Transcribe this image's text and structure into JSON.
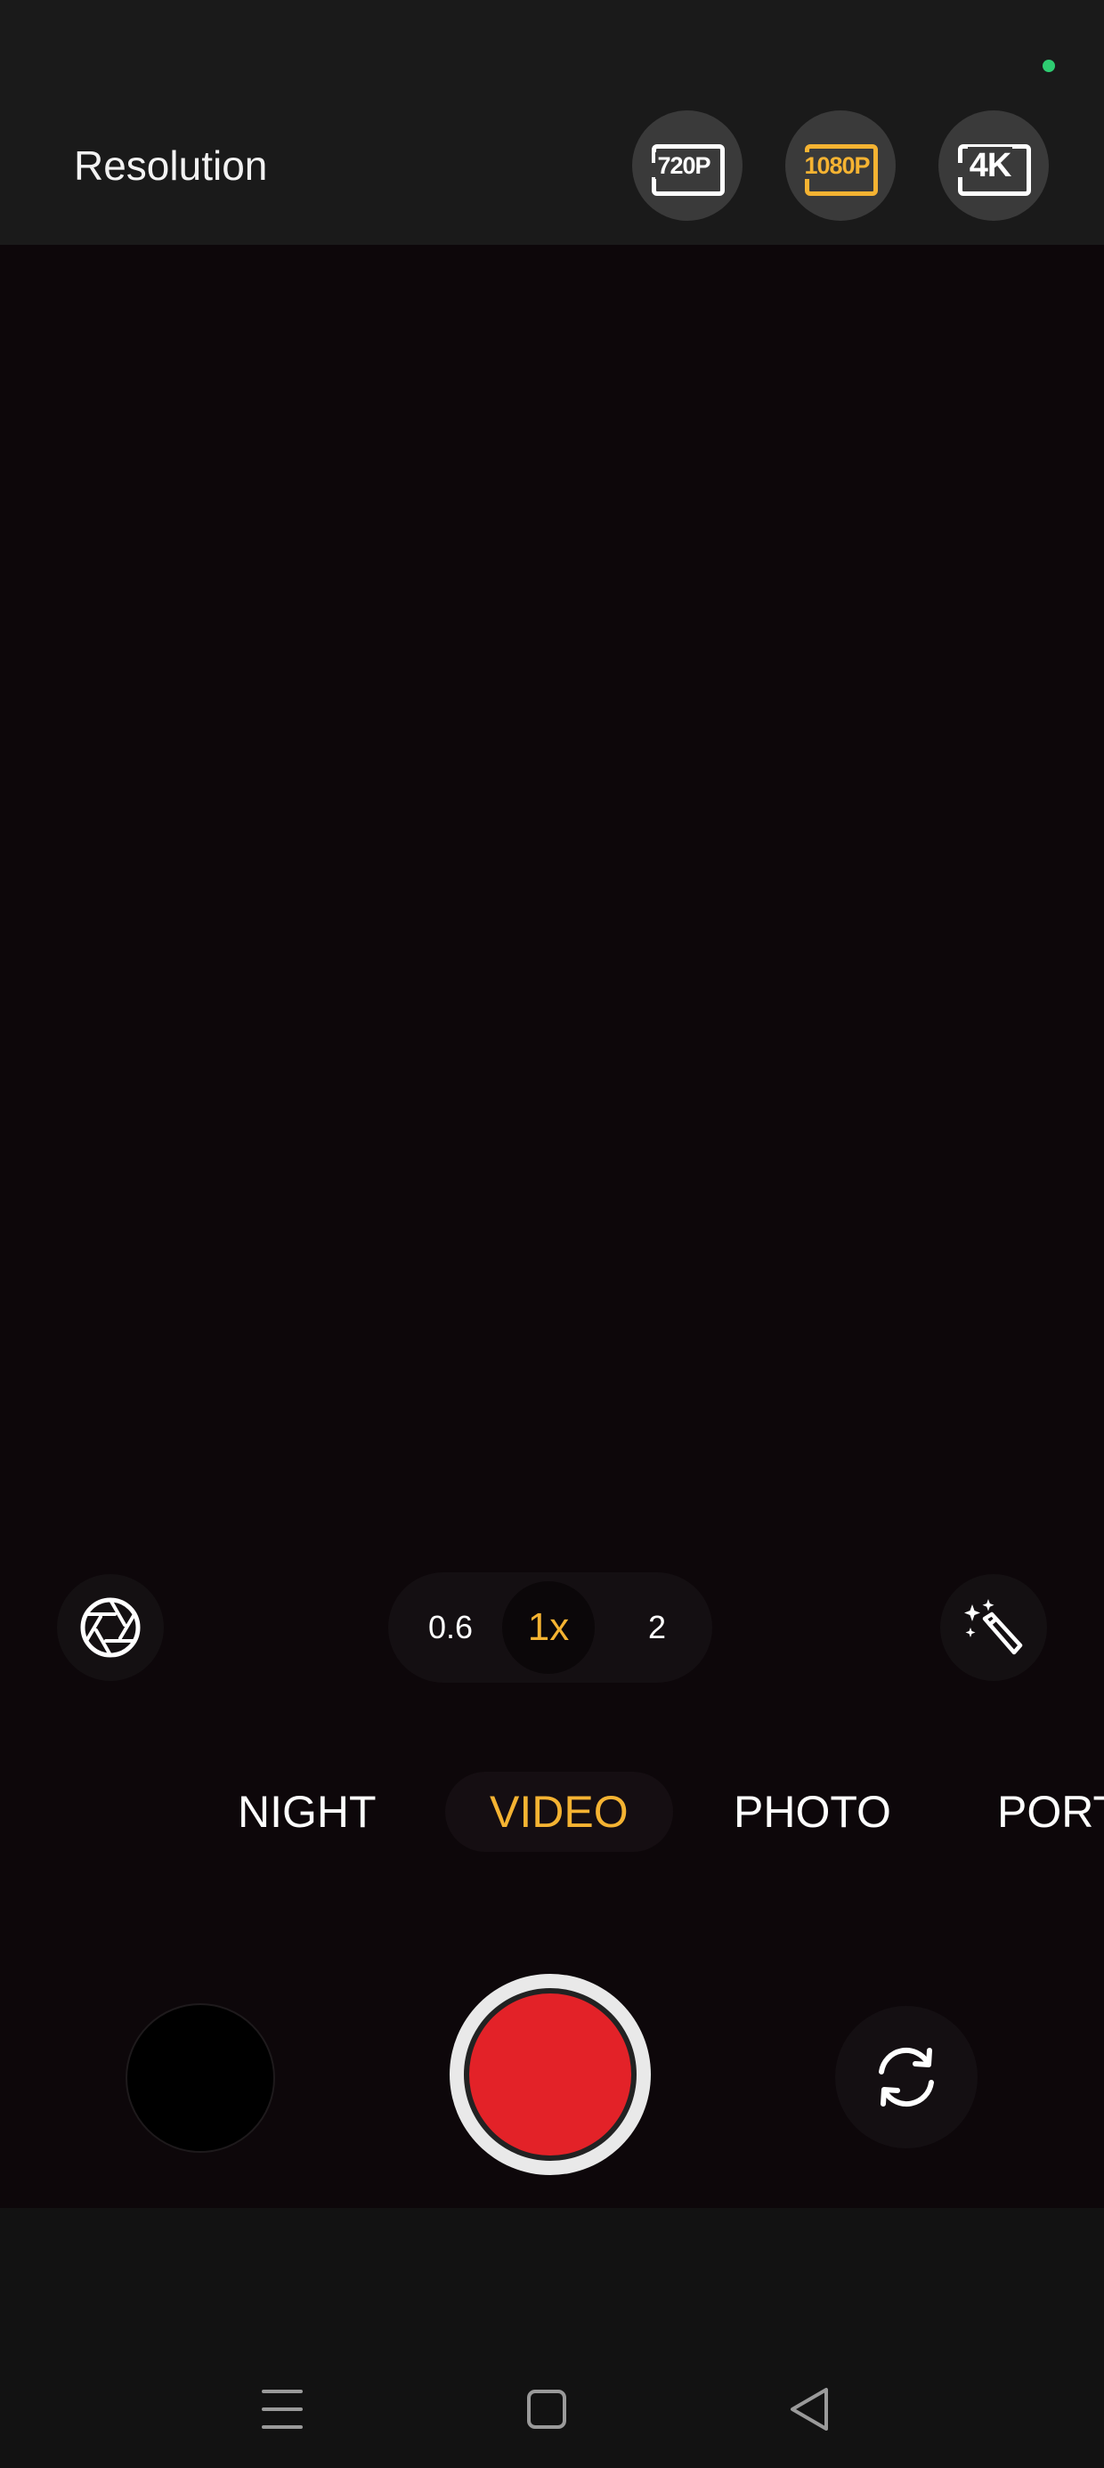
{
  "header": {
    "title": "Resolution",
    "options": [
      {
        "label": "720P",
        "selected": false
      },
      {
        "label": "1080P",
        "selected": true
      },
      {
        "label": "4K",
        "selected": false
      }
    ],
    "status_dot_color": "#2ecc71"
  },
  "controls": {
    "left_icon": "aperture-icon",
    "right_icon": "magic-wand-icon",
    "zoom": {
      "options": [
        "0.6",
        "1x",
        "2"
      ],
      "selected": "1x"
    }
  },
  "modes": {
    "items": [
      "NIGHT",
      "VIDEO",
      "PHOTO",
      "PORT"
    ],
    "selected": "VIDEO"
  },
  "bottom": {
    "shutter_color": "#e32228",
    "flip_icon": "camera-flip-icon",
    "gallery": "gallery-thumbnail"
  },
  "nav": {
    "icons": [
      "menu-icon",
      "home-icon",
      "back-icon"
    ]
  },
  "colors": {
    "accent": "#f5b332",
    "record": "#e32228"
  }
}
